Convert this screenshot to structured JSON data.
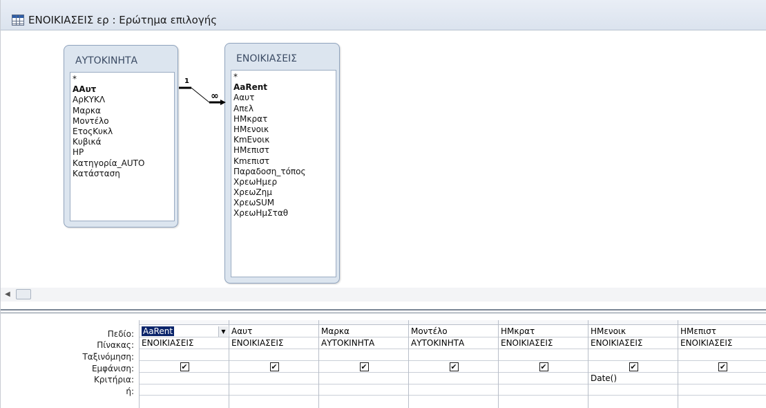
{
  "window": {
    "title": "ΕΝΟΙΚΙΑΣΕΙΣ ερ : Ερώτημα επιλογής",
    "icon": "query-grid-icon"
  },
  "tables": [
    {
      "name": "ΑΥΤΟΚΙΝΗΤΑ",
      "fields": [
        {
          "label": "*",
          "bold": false
        },
        {
          "label": "ΑΑυτ",
          "bold": true
        },
        {
          "label": "ΑρΚΥΚΛ",
          "bold": false
        },
        {
          "label": "Μαρκα",
          "bold": false
        },
        {
          "label": "Μοντέλο",
          "bold": false
        },
        {
          "label": "ΕτοςΚυκλ",
          "bold": false
        },
        {
          "label": "Κυβικά",
          "bold": false
        },
        {
          "label": "HP",
          "bold": false
        },
        {
          "label": "Κατηγορία_AUTO",
          "bold": false
        },
        {
          "label": "Κατάσταση",
          "bold": false
        }
      ]
    },
    {
      "name": "ΕΝΟΙΚΙΑΣΕΙΣ",
      "fields": [
        {
          "label": "*",
          "bold": false
        },
        {
          "label": "AaRent",
          "bold": true
        },
        {
          "label": "Ααυτ",
          "bold": false
        },
        {
          "label": "Απελ",
          "bold": false
        },
        {
          "label": "ΗΜκρατ",
          "bold": false
        },
        {
          "label": "ΗΜενοικ",
          "bold": false
        },
        {
          "label": "ΚmΕνοικ",
          "bold": false
        },
        {
          "label": "ΗΜεπιστ",
          "bold": false
        },
        {
          "label": "Κmεπιστ",
          "bold": false
        },
        {
          "label": "Παραδοση_τόπος",
          "bold": false
        },
        {
          "label": "ΧρεωΗμερ",
          "bold": false
        },
        {
          "label": "ΧρεωΖημ",
          "bold": false
        },
        {
          "label": "ΧρεωSUM",
          "bold": false
        },
        {
          "label": "ΧρεωΗμΣταθ",
          "bold": false
        }
      ]
    }
  ],
  "relationship": {
    "one_label": "1",
    "many_label": "∞"
  },
  "grid": {
    "row_labels": [
      "Πεδίο:",
      "Πίνακας:",
      "Ταξινόμηση:",
      "Εμφάνιση:",
      "Κριτήρια:",
      "ή:"
    ],
    "columns": [
      {
        "field": "AaRent",
        "table": "ΕΝΟΙΚΙΑΣΕΙΣ",
        "sort": "",
        "show": true,
        "criteria": "",
        "or": "",
        "selected": true
      },
      {
        "field": "Ααυτ",
        "table": "ΕΝΟΙΚΙΑΣΕΙΣ",
        "sort": "",
        "show": true,
        "criteria": "",
        "or": "",
        "selected": false
      },
      {
        "field": "Μαρκα",
        "table": "ΑΥΤΟΚΙΝΗΤΑ",
        "sort": "",
        "show": true,
        "criteria": "",
        "or": "",
        "selected": false
      },
      {
        "field": "Μοντέλο",
        "table": "ΑΥΤΟΚΙΝΗΤΑ",
        "sort": "",
        "show": true,
        "criteria": "",
        "or": "",
        "selected": false
      },
      {
        "field": "ΗΜκρατ",
        "table": "ΕΝΟΙΚΙΑΣΕΙΣ",
        "sort": "",
        "show": true,
        "criteria": "",
        "or": "",
        "selected": false
      },
      {
        "field": "ΗΜενοικ",
        "table": "ΕΝΟΙΚΙΑΣΕΙΣ",
        "sort": "",
        "show": true,
        "criteria": "Date()",
        "or": "",
        "selected": false
      },
      {
        "field": "ΗΜεπιστ",
        "table": "ΕΝΟΙΚΙΑΣΕΙΣ",
        "sort": "",
        "show": true,
        "criteria": "",
        "or": "",
        "selected": false
      }
    ]
  },
  "icons": {
    "checkbox": "✔",
    "dropdown": "▼",
    "scroll_left": "◀"
  }
}
